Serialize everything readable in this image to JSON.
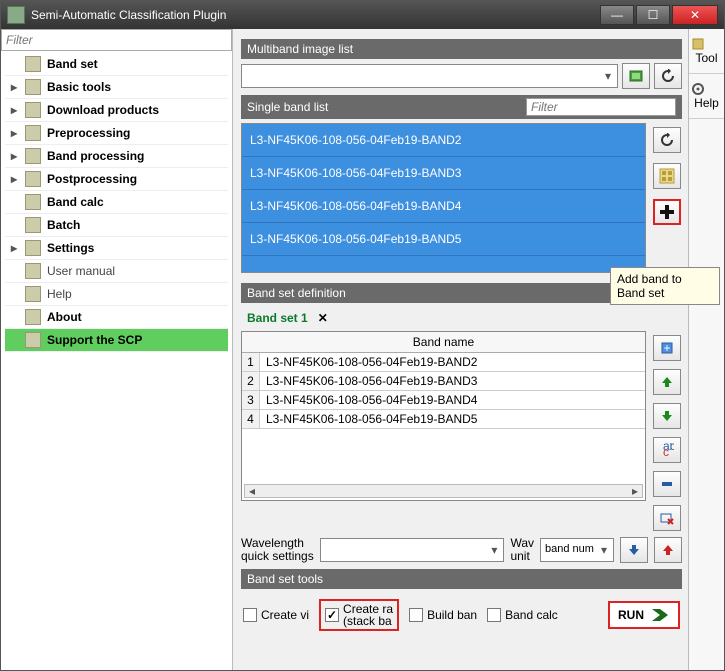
{
  "window": {
    "title": "Semi-Automatic Classification Plugin"
  },
  "left_filter_placeholder": "Filter",
  "tree": [
    {
      "label": "Band set",
      "bold": true,
      "expand": ""
    },
    {
      "label": "Basic tools",
      "bold": true,
      "expand": "▸"
    },
    {
      "label": "Download products",
      "bold": true,
      "expand": "▸"
    },
    {
      "label": "Preprocessing",
      "bold": true,
      "expand": "▸"
    },
    {
      "label": "Band processing",
      "bold": true,
      "expand": "▸"
    },
    {
      "label": "Postprocessing",
      "bold": true,
      "expand": "▸"
    },
    {
      "label": "Band calc",
      "bold": true,
      "expand": ""
    },
    {
      "label": "Batch",
      "bold": true,
      "expand": ""
    },
    {
      "label": "Settings",
      "bold": true,
      "expand": "▸"
    },
    {
      "label": "User manual",
      "bold": false,
      "expand": ""
    },
    {
      "label": "Help",
      "bold": false,
      "expand": ""
    },
    {
      "label": "About",
      "bold": true,
      "expand": ""
    },
    {
      "label": "Support the SCP",
      "bold": true,
      "expand": "",
      "highlight": true
    }
  ],
  "sections": {
    "multiband": "Multiband image list",
    "single": "Single band list",
    "filter_placeholder": "Filter",
    "definition": "Band set definition",
    "tools": "Band set tools"
  },
  "single_bands": [
    "L3-NF45K06-108-056-04Feb19-BAND2",
    "L3-NF45K06-108-056-04Feb19-BAND3",
    "L3-NF45K06-108-056-04Feb19-BAND4",
    "L3-NF45K06-108-056-04Feb19-BAND5"
  ],
  "tab_label": "Band set 1",
  "band_table_header": "Band name",
  "band_table": [
    "L3-NF45K06-108-056-04Feb19-BAND2",
    "L3-NF45K06-108-056-04Feb19-BAND3",
    "L3-NF45K06-108-056-04Feb19-BAND4",
    "L3-NF45K06-108-056-04Feb19-BAND5"
  ],
  "wavelength": {
    "quick_label": "Wavelength\nquick settings",
    "unit_label": "Wav\nunit",
    "unit_value": "band num"
  },
  "tools": {
    "create_vi": "Create vi",
    "create_ra": "Create ra\n(stack ba",
    "build_ban": "Build ban",
    "band_calc": "Band calc",
    "run": "RUN"
  },
  "sidetabs": {
    "tool": "Tool",
    "help": "Help"
  },
  "tooltip": "Add band to Band set"
}
